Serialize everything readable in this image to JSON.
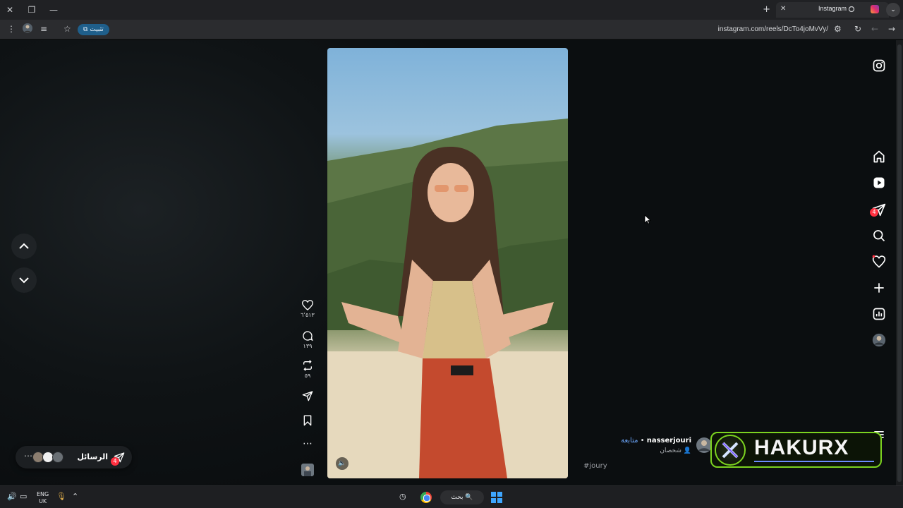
{
  "browser": {
    "tab_title": "Instagram",
    "url": "instagram.com/reels/DcTo4joMvVy/",
    "pin_label": "تثبيت",
    "new_tab": "+",
    "tab_close": "✕"
  },
  "reel": {
    "likes": "٦٬٥١٣",
    "comments": "١٣٩",
    "reposts": "٥٩",
    "username": "nasserjouri",
    "follow_label": "متابعة",
    "subtitle": "شخصان",
    "hashtag": "#joury"
  },
  "messages": {
    "label": "الرسائل",
    "badge": "4"
  },
  "nav": {
    "notification_badge": "4"
  },
  "overlay": {
    "brand": "HAKURX"
  },
  "taskbar": {
    "lang_top": "ENG",
    "lang_bottom": "UK",
    "search_label": "بحث"
  },
  "colors": {
    "accent_blue": "#6ea8fe",
    "badge_red": "#ff3040",
    "banner_green": "#7cd320"
  }
}
